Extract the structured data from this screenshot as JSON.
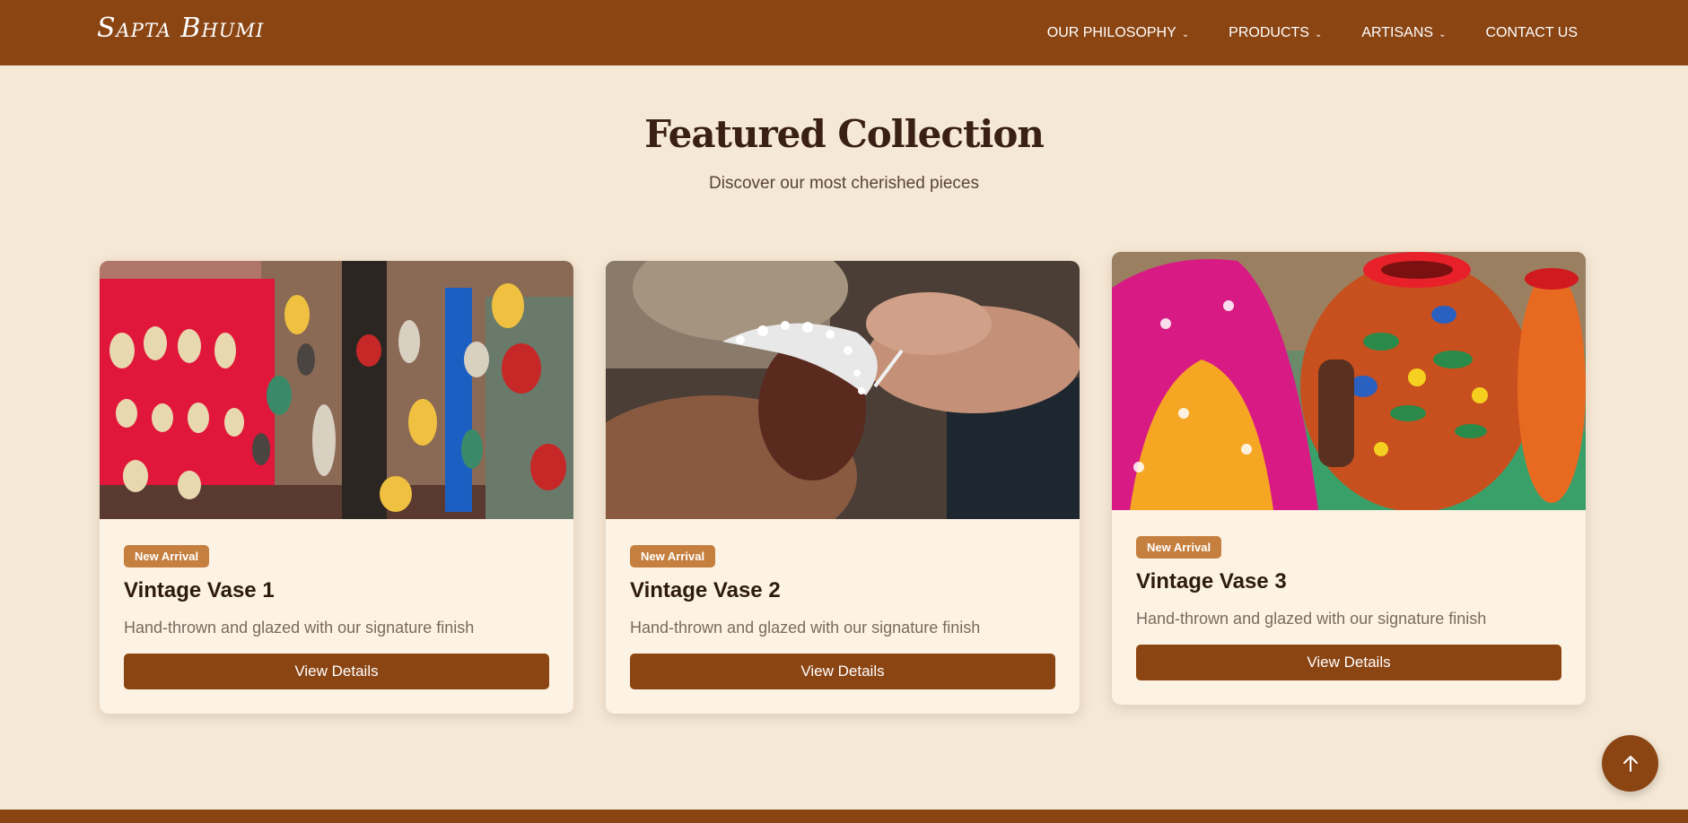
{
  "nav": {
    "logo": "Sapta Bhumi",
    "items": [
      {
        "label": "OUR PHILOSOPHY",
        "has_dropdown": true
      },
      {
        "label": "PRODUCTS",
        "has_dropdown": true
      },
      {
        "label": "ARTISANS",
        "has_dropdown": true
      },
      {
        "label": "CONTACT US",
        "has_dropdown": false
      }
    ],
    "chevron": "⌄"
  },
  "section": {
    "title": "Featured Collection",
    "subtitle": "Discover our most cherished pieces"
  },
  "products": [
    {
      "badge": "New Arrival",
      "title": "Vintage Vase 1",
      "description": "Hand-thrown and glazed with our signature finish",
      "button": "View Details",
      "image": "masks-photo"
    },
    {
      "badge": "New Arrival",
      "title": "Vintage Vase 2",
      "description": "Hand-thrown and glazed with our signature finish",
      "button": "View Details",
      "image": "jewelry-crafting-photo"
    },
    {
      "badge": "New Arrival",
      "title": "Vintage Vase 3",
      "description": "Hand-thrown and glazed with our signature finish",
      "button": "View Details",
      "image": "pottery-painting-photo"
    }
  ],
  "scroll_top": {
    "icon": "arrow-up-icon"
  },
  "colors": {
    "brand": "#8b4513",
    "background": "#f5e8d5",
    "card": "#fdf3e4",
    "badge": "#c57f3f"
  }
}
